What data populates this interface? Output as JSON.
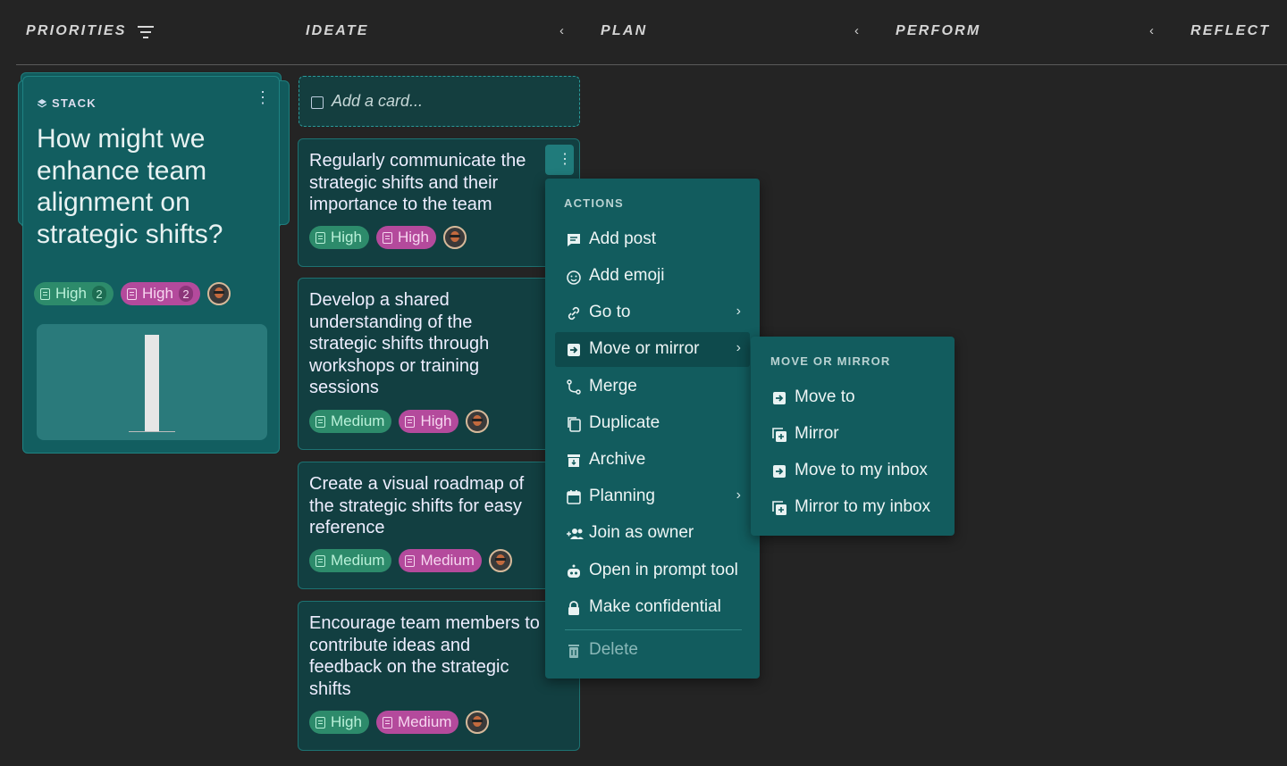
{
  "columns": [
    {
      "label": "PRIORITIES"
    },
    {
      "label": "IDEATE"
    },
    {
      "label": "PLAN"
    },
    {
      "label": "PERFORM"
    },
    {
      "label": "REFLECT"
    }
  ],
  "stack": {
    "label": "STACK",
    "title": "How might we enhance team alignment on strategic shifts?",
    "tags": [
      {
        "label": "High",
        "count": "2",
        "color": "#2d8b6b"
      },
      {
        "label": "High",
        "count": "2",
        "color": "#b44a9c"
      }
    ]
  },
  "add_card": {
    "placeholder": "Add a card..."
  },
  "cards": [
    {
      "text": "Regularly communicate the strategic shifts and their importance to the team",
      "tag1": "High",
      "tag2": "High"
    },
    {
      "text": "Develop a shared understanding of the strategic shifts through workshops or training sessions",
      "tag1": "Medium",
      "tag2": "High"
    },
    {
      "text": "Create a visual roadmap of the strategic shifts for easy reference",
      "tag1": "Medium",
      "tag2": "Medium"
    },
    {
      "text": "Encourage team members to contribute ideas and feedback on the strategic shifts",
      "tag1": "High",
      "tag2": "Medium"
    }
  ],
  "actions_menu": {
    "header": "ACTIONS",
    "items": [
      {
        "label": "Add post",
        "icon": "post-icon"
      },
      {
        "label": "Add emoji",
        "icon": "emoji-icon"
      },
      {
        "label": "Go to",
        "icon": "link-icon"
      },
      {
        "label": "Move or mirror",
        "icon": "move-icon"
      },
      {
        "label": "Merge",
        "icon": "merge-icon"
      },
      {
        "label": "Duplicate",
        "icon": "duplicate-icon"
      },
      {
        "label": "Archive",
        "icon": "archive-icon"
      },
      {
        "label": "Planning",
        "icon": "calendar-icon"
      },
      {
        "label": "Join as owner",
        "icon": "join-icon"
      },
      {
        "label": "Open in prompt tool",
        "icon": "robot-icon"
      },
      {
        "label": "Make confidential",
        "icon": "lock-icon"
      },
      {
        "label": "Delete",
        "icon": "trash-icon"
      }
    ]
  },
  "submenu": {
    "header": "MOVE OR MIRROR",
    "items": [
      {
        "label": "Move to"
      },
      {
        "label": "Mirror"
      },
      {
        "label": "Move to my inbox"
      },
      {
        "label": "Mirror to my inbox"
      }
    ]
  },
  "colors": {
    "background": "#242424",
    "card": "#123f41",
    "menu": "#125c5e",
    "tag_green": "#2d8b6b",
    "tag_pink": "#b44a9c"
  }
}
